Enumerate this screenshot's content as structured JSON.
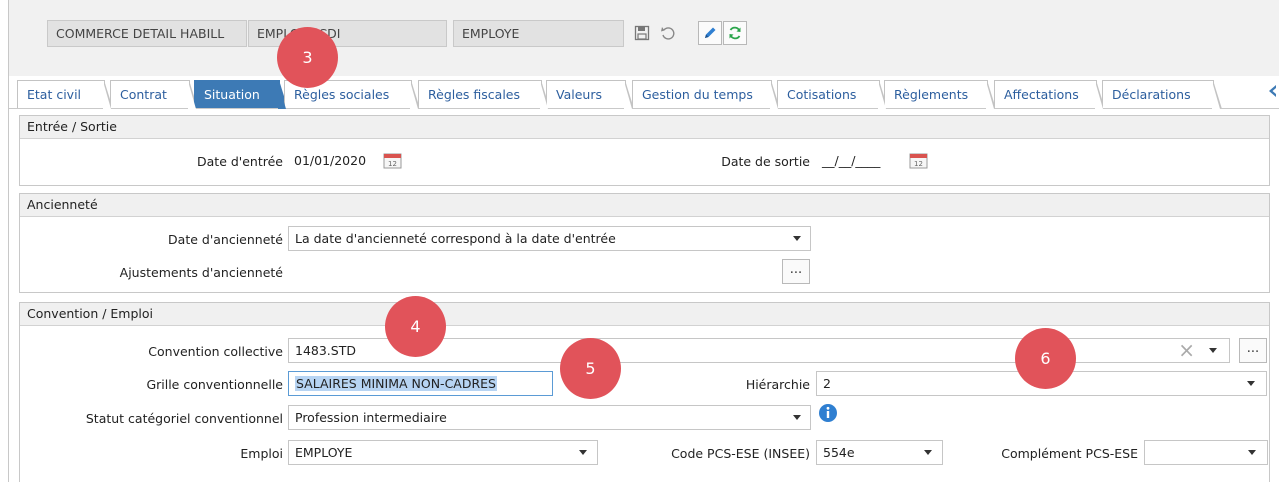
{
  "header": {
    "convention_field": "COMMERCE DETAIL HABILL",
    "contract_field": "EMPLOYE CDI",
    "status_field": "EMPLOYE"
  },
  "tabs": [
    {
      "label": "Etat civil"
    },
    {
      "label": "Contrat"
    },
    {
      "label": "Situation"
    },
    {
      "label": "Règles sociales"
    },
    {
      "label": "Règles fiscales"
    },
    {
      "label": "Valeurs"
    },
    {
      "label": "Gestion du temps"
    },
    {
      "label": "Cotisations"
    },
    {
      "label": "Règlements"
    },
    {
      "label": "Affectations"
    },
    {
      "label": "Déclarations"
    }
  ],
  "active_tab": "Situation",
  "entry_exit": {
    "title": "Entrée / Sortie",
    "entry_label": "Date d'entrée",
    "entry_value": "01/01/2020",
    "exit_label": "Date de sortie",
    "exit_value": "__/__/____"
  },
  "seniority": {
    "title": "Ancienneté",
    "date_label": "Date d'ancienneté",
    "date_value": "La date d'ancienneté correspond à la date d'entrée",
    "adjust_label": "Ajustements d'ancienneté",
    "dots": "..."
  },
  "convention": {
    "title": "Convention / Emploi",
    "cc_label": "Convention collective",
    "cc_value": "1483.STD",
    "grid_label": "Grille conventionnelle",
    "grid_value": "SALAIRES MINIMA NON-CADRES",
    "hierarchy_label": "Hiérarchie",
    "hierarchy_value": "2",
    "status_label": "Statut catégoriel conventionnel",
    "status_value": "Profession intermediaire",
    "job_label": "Emploi",
    "job_value": "EMPLOYE",
    "pcs_label": "Code PCS-ESE (INSEE)",
    "pcs_value": "554e",
    "pcs_comp_label": "Complément PCS-ESE",
    "pcs_comp_value": "",
    "dots": "...",
    "clear_glyph": "×"
  },
  "callouts": {
    "c3": "3",
    "c4": "4",
    "c5": "5",
    "c6": "6"
  },
  "colors": {
    "active_tab": "#3d7ab5",
    "tab_text": "#2c5e9e",
    "callout": "#e1535a",
    "selection": "#b7d4f3",
    "info_icon": "#2f7fd1"
  }
}
